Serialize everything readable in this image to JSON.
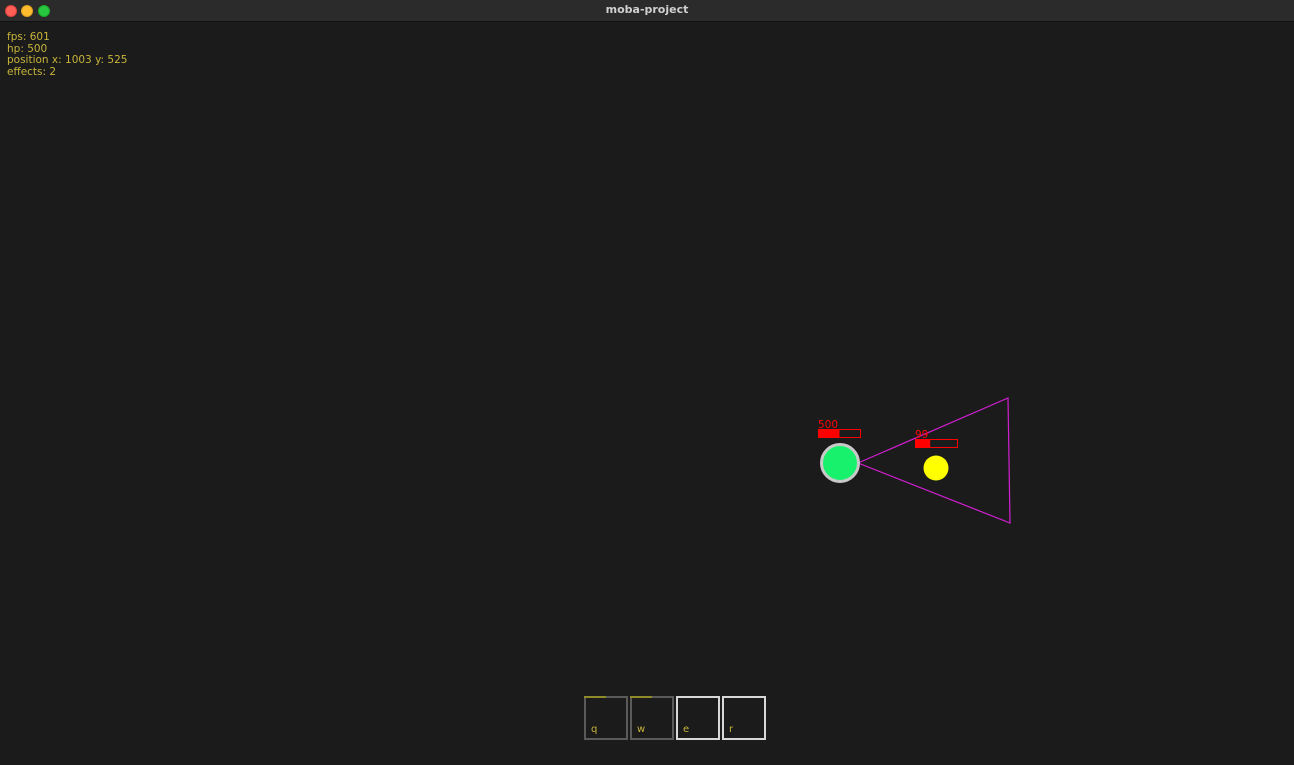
{
  "window": {
    "title": "moba-project"
  },
  "hud": {
    "fps": "fps: 601",
    "hp": "hp: 500",
    "position": "position x: 1003 y: 525",
    "effects": "effects: 2"
  },
  "player": {
    "hp_label": "500",
    "hp_fraction": 0.5,
    "color": "#17f16b",
    "ring_color": "#c9c9c9"
  },
  "enemy": {
    "hp_label": "99",
    "hp_fraction": 0.35,
    "color": "#ffff00"
  },
  "skillshot": {
    "color": "#d21fd2"
  },
  "colors": {
    "background": "#1b1b1b",
    "hud_text": "#c8b43a",
    "healthbar": "#ff0000"
  },
  "abilities": [
    {
      "key": "q",
      "state": "cooldown"
    },
    {
      "key": "w",
      "state": "cooldown"
    },
    {
      "key": "e",
      "state": "ready"
    },
    {
      "key": "r",
      "state": "ready"
    }
  ]
}
